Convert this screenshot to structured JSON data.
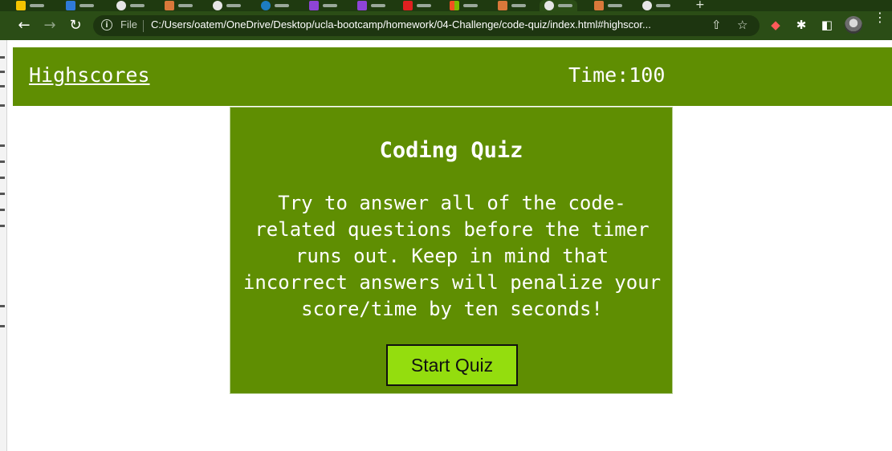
{
  "browser": {
    "address": {
      "scheme_label": "File",
      "url": "C:/Users/oatem/OneDrive/Desktop/ucla-bootcamp/homework/04-Challenge/code-quiz/index.html#highscor..."
    },
    "new_tab_label": "+",
    "accent_color": "#2b4d16"
  },
  "page": {
    "header": {
      "highscores_link": "Highscores",
      "timer_label": "Time:100"
    },
    "card": {
      "title": "Coding Quiz",
      "description": "Try to answer all of the code-related questions before the timer runs out. Keep in mind that incorrect answers will penalize your score/time by ten seconds!",
      "start_button": "Start Quiz"
    },
    "colors": {
      "header_bg": "#5f8e02",
      "card_bg": "#5f8e02",
      "button_bg": "#94dd0e"
    }
  }
}
